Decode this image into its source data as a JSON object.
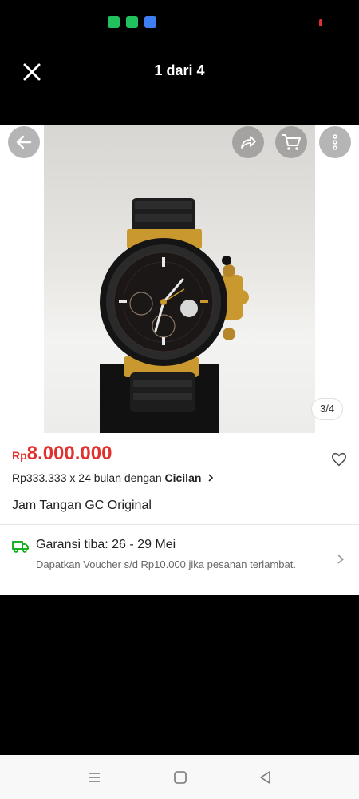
{
  "header": {
    "page_counter": "1 dari 4"
  },
  "gallery": {
    "image_counter": "3/4"
  },
  "product": {
    "price_prefix": "Rp",
    "price_value": "8.000.000",
    "installment_prefix": "Rp333.333 x 24 bulan dengan ",
    "installment_link": "Cicilan",
    "title": "Jam Tangan GC Original"
  },
  "shipping": {
    "title": "Garansi tiba: 26 - 29 Mei",
    "note": "Dapatkan Voucher s/d Rp10.000 jika pesanan terlambat."
  },
  "icons": {
    "close": "close-icon",
    "back": "arrow-left-icon",
    "share": "share-icon",
    "cart": "cart-icon",
    "more": "more-vertical-icon",
    "wishlist": "heart-icon",
    "shipping": "truck-icon",
    "chevron": "chevron-right-icon"
  },
  "colors": {
    "price": "#e0312f",
    "truck": "#03ac0e",
    "background": "#000000"
  }
}
